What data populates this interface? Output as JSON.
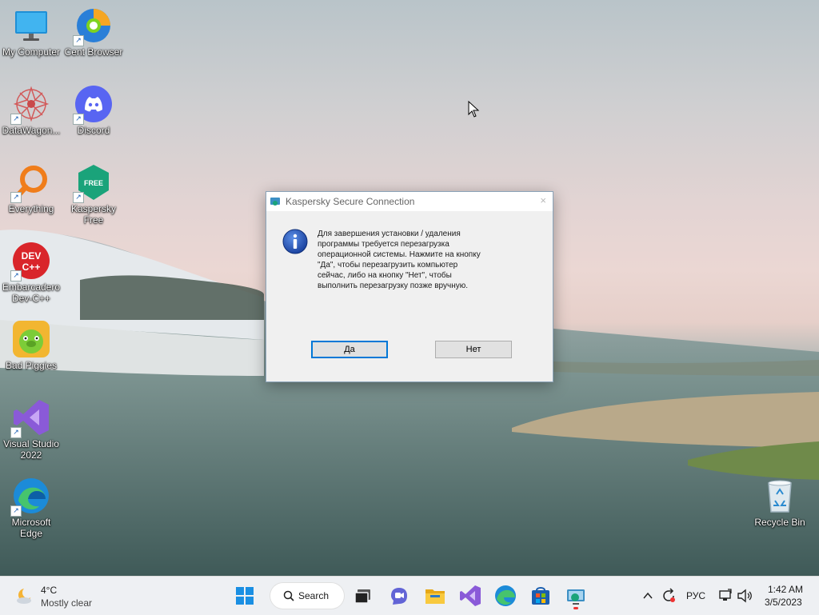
{
  "desktop": {
    "icons": [
      {
        "label": "My Computer",
        "icon": "monitor-icon"
      },
      {
        "label": "Cent Browser",
        "icon": "cent-browser-icon"
      },
      {
        "label": "DataWagon...",
        "icon": "datawagon-icon"
      },
      {
        "label": "Discord",
        "icon": "discord-icon"
      },
      {
        "label": "Everything",
        "icon": "everything-search-icon"
      },
      {
        "label": "Kaspersky Free",
        "icon": "kaspersky-free-icon",
        "badge": "FREE"
      },
      {
        "label": "Embarcadero Dev-C++",
        "icon": "devcpp-icon",
        "badge": "DEV C++"
      },
      {
        "label": "Bad Piggies",
        "icon": "bad-piggies-icon"
      },
      {
        "label": "Visual Studio 2022",
        "icon": "visual-studio-icon"
      },
      {
        "label": "Microsoft Edge",
        "icon": "edge-icon"
      },
      {
        "label": "Recycle Bin",
        "icon": "recycle-bin-icon"
      }
    ]
  },
  "dialog": {
    "title": "Kaspersky Secure Connection",
    "close_glyph": "×",
    "message_lines": [
      "Для завершения установки / удаления",
      "программы требуется перезагрузка",
      "операционной системы. Нажмите на кнопку",
      "\"Да\", чтобы перезагрузить компьютер",
      "сейчас, либо на кнопку \"Нет\", чтобы",
      "выполнить перезагрузку позже вручную."
    ],
    "yes_label": "Да",
    "no_label": "Нет",
    "icon": "info-icon"
  },
  "taskbar": {
    "weather": {
      "temp": "4°C",
      "condition": "Mostly clear"
    },
    "search_label": "Search",
    "apps": [
      "start-icon",
      "search-icon",
      "task-view-icon",
      "teams-chat-icon",
      "file-explorer-icon",
      "visual-studio-icon",
      "edge-icon",
      "store-icon",
      "kaspersky-connection-icon"
    ],
    "tray": {
      "language": "РУС",
      "time": "1:42 AM",
      "date": "3/5/2023"
    }
  },
  "colors": {
    "accent": "#0078d7",
    "dialog_bg": "#f0f0f0",
    "taskbar_bg": "#eef0f3"
  }
}
